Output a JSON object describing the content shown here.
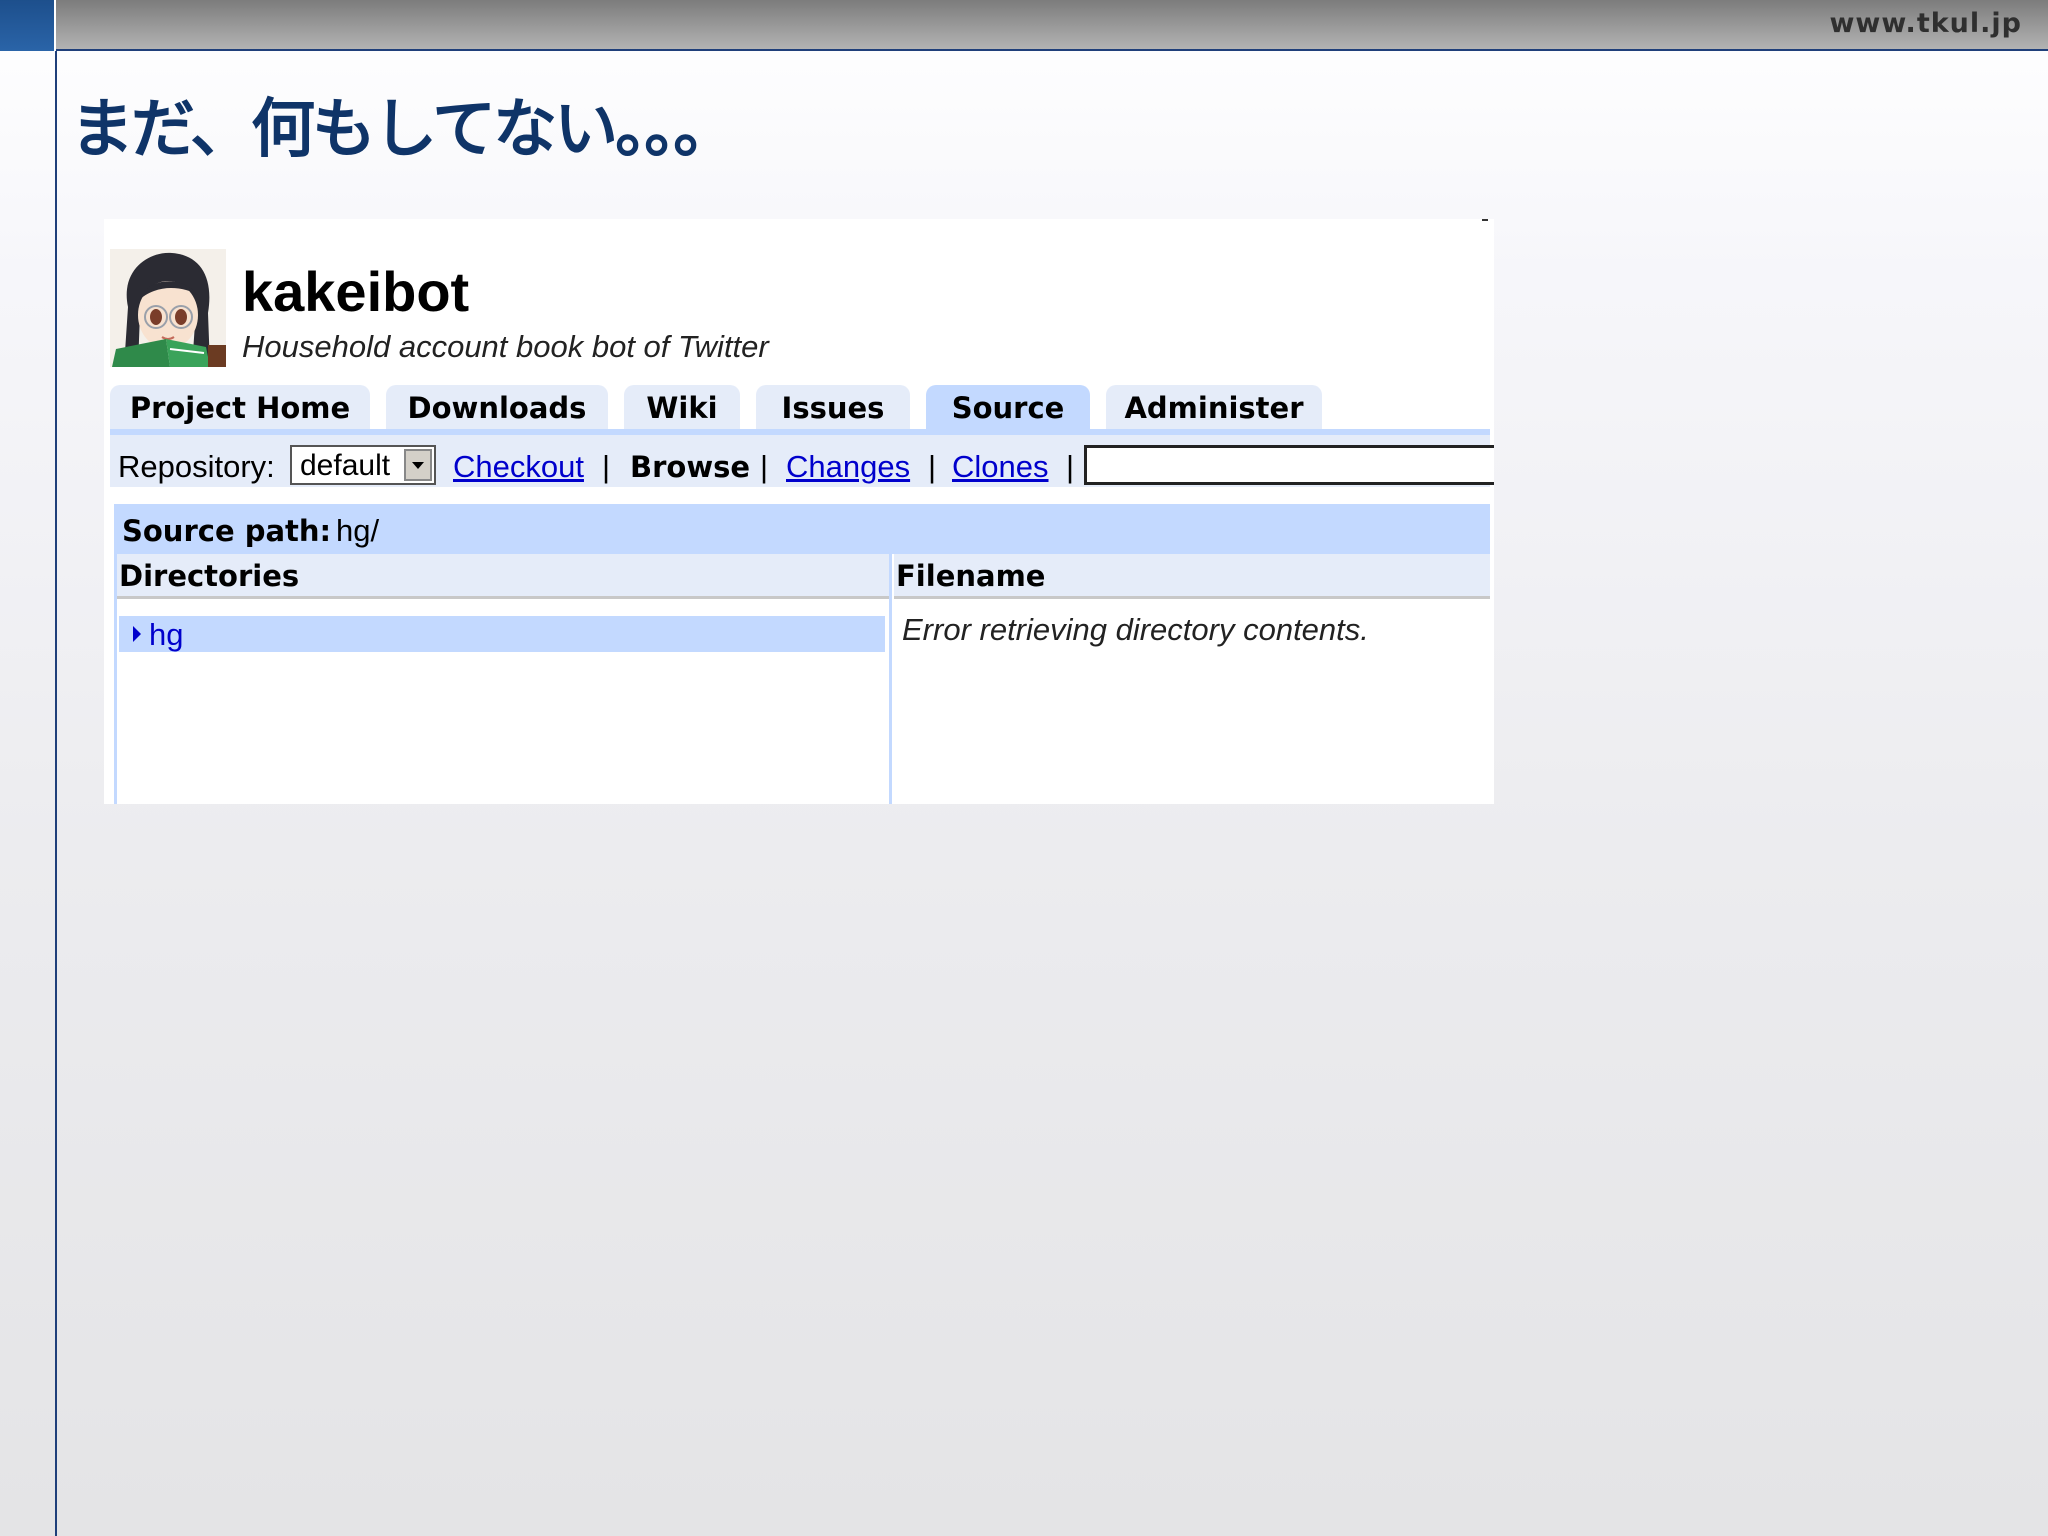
{
  "slide": {
    "site_url": "www.tkul.jp",
    "title": "まだ、何もしてない。。。"
  },
  "project": {
    "name": "kakeibot",
    "summary": "Household account book bot of Twitter",
    "logo_icon": "anime-girl-reading-avatar"
  },
  "tabs": [
    {
      "label": "Project Home",
      "active": false
    },
    {
      "label": "Downloads",
      "active": false
    },
    {
      "label": "Wiki",
      "active": false
    },
    {
      "label": "Issues",
      "active": false
    },
    {
      "label": "Source",
      "active": true
    },
    {
      "label": "Administer",
      "active": false
    }
  ],
  "subnav": {
    "repository_label": "Repository:",
    "repository_value": "default",
    "checkout": "Checkout",
    "browse": "Browse",
    "changes": "Changes",
    "clones": "Clones",
    "separator": "|",
    "search_value": ""
  },
  "source": {
    "path_label": "Source path:",
    "path_value": "hg/",
    "directories_header": "Directories",
    "filename_header": "Filename",
    "directories": [
      {
        "name": "hg"
      }
    ],
    "error_message": "Error retrieving directory contents."
  },
  "colors": {
    "title_blue": "#0f3468",
    "tab_active": "#c3d9ff",
    "tab_inactive": "#e5ecf9",
    "link": "#0000cc"
  }
}
